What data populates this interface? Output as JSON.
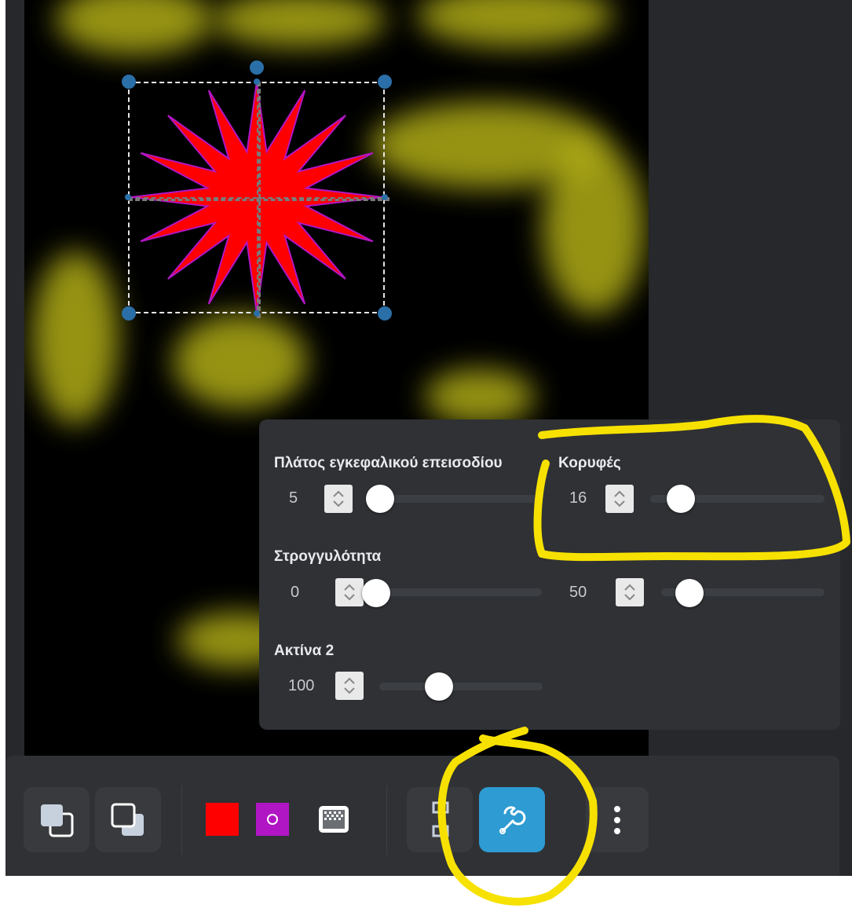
{
  "colors": {
    "fill": "#ff0000",
    "stroke": "#b116c4",
    "accent": "#2e9bd2",
    "highlight": "#f7e100"
  },
  "canvas": {
    "shape": "star",
    "selected": true
  },
  "panel": {
    "stroke_width": {
      "label": "Πλάτος εγκεφαλικού επεισοδίου",
      "value": "5",
      "level": 0.0
    },
    "vertices": {
      "label": "Κορυφές",
      "value": "16",
      "level": 0.2
    },
    "roundness": {
      "label": "Στρογγυλότητα",
      "value": "0",
      "level": 0.0
    },
    "roundness2": {
      "value": "50",
      "level": 0.17
    },
    "radius2": {
      "label": "Ακτίνα 2",
      "value": "100",
      "level": 0.37
    }
  },
  "toolbar": {
    "icons": [
      "bring-forward-icon",
      "send-backward-icon",
      "fill-color-icon",
      "stroke-color-icon",
      "pattern-icon",
      "align-icon",
      "wrench-icon",
      "more-icon"
    ]
  }
}
